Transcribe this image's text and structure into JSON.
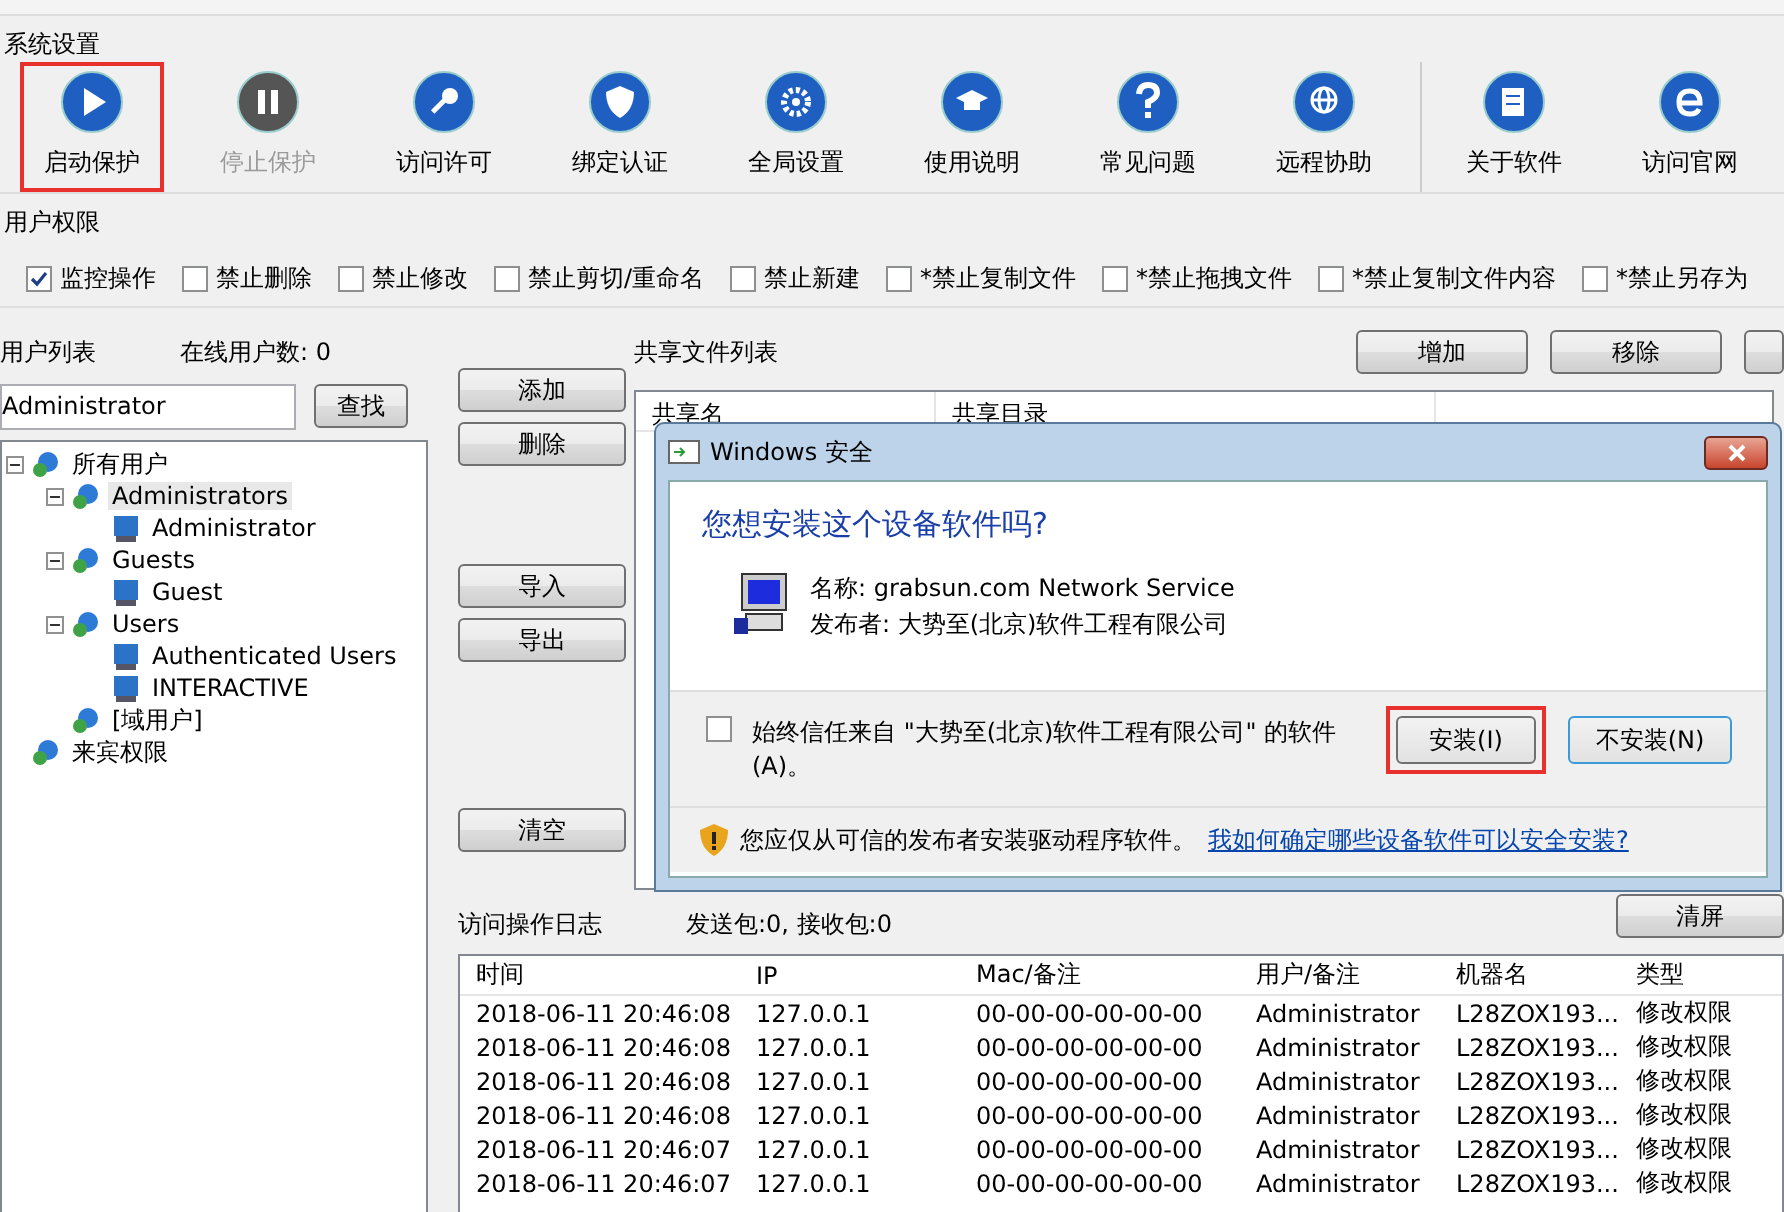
{
  "system_settings": {
    "title": "系统设置",
    "groups": [
      [
        {
          "label": "启动保护",
          "kind": "play",
          "disabled": false,
          "highlighted": true
        },
        {
          "label": "停止保护",
          "kind": "pause",
          "disabled": true,
          "highlighted": false
        },
        {
          "label": "访问许可",
          "kind": "key",
          "disabled": false,
          "highlighted": false
        },
        {
          "label": "绑定认证",
          "kind": "shield",
          "disabled": false,
          "highlighted": false
        },
        {
          "label": "全局设置",
          "kind": "gear",
          "disabled": false,
          "highlighted": false
        },
        {
          "label": "使用说明",
          "kind": "cap",
          "disabled": false,
          "highlighted": false
        },
        {
          "label": "常见问题",
          "kind": "question",
          "disabled": false,
          "highlighted": false
        },
        {
          "label": "远程协助",
          "kind": "globe",
          "disabled": false,
          "highlighted": false
        }
      ],
      [
        {
          "label": "关于软件",
          "kind": "note",
          "disabled": false,
          "highlighted": false
        },
        {
          "label": "访问官网",
          "kind": "browser",
          "disabled": false,
          "highlighted": false
        }
      ]
    ]
  },
  "user_permissions": {
    "title": "用户权限",
    "options": [
      {
        "label": "监控操作",
        "checked": true
      },
      {
        "label": "禁止删除",
        "checked": false
      },
      {
        "label": "禁止修改",
        "checked": false
      },
      {
        "label": "禁止剪切/重命名",
        "checked": false
      },
      {
        "label": "禁止新建",
        "checked": false
      },
      {
        "label": "*禁止复制文件",
        "checked": false
      },
      {
        "label": "*禁止拖拽文件",
        "checked": false
      },
      {
        "label": "*禁止复制文件内容",
        "checked": false
      },
      {
        "label": "*禁止另存为",
        "checked": false
      }
    ]
  },
  "user_list": {
    "title": "用户列表",
    "online_count": "在线用户数: 0",
    "search_value": "Administrator",
    "search_button": "查找",
    "tree": [
      {
        "label": "所有用户",
        "kind": "group",
        "expanded": true,
        "selected": false,
        "children": [
          {
            "label": "Administrators",
            "kind": "group",
            "expanded": true,
            "selected": true,
            "children": [
              {
                "label": "Administrator",
                "kind": "user",
                "selected": false
              }
            ]
          },
          {
            "label": "Guests",
            "kind": "group",
            "expanded": true,
            "selected": false,
            "children": [
              {
                "label": "Guest",
                "kind": "user",
                "selected": false
              }
            ]
          },
          {
            "label": "Users",
            "kind": "group",
            "expanded": true,
            "selected": false,
            "children": [
              {
                "label": "Authenticated Users",
                "kind": "user",
                "selected": false
              },
              {
                "label": "INTERACTIVE",
                "kind": "user",
                "selected": false
              }
            ]
          },
          {
            "label": "[域用户]",
            "kind": "group",
            "selected": false
          }
        ]
      },
      {
        "label": "来宾权限",
        "kind": "group",
        "selected": false
      }
    ]
  },
  "middle_buttons": {
    "top": [
      "添加",
      "删除"
    ],
    "middle": [
      "导入",
      "导出"
    ],
    "bottom": [
      "清空"
    ]
  },
  "share_list": {
    "title": "共享文件列表",
    "buttons": [
      "增加",
      "移除"
    ],
    "columns": [
      "共享名",
      "共享目录"
    ]
  },
  "log": {
    "title": "访问操作日志",
    "stats": "发送包:0, 接收包:0",
    "clear_button": "清屏",
    "columns": [
      "时间",
      "IP",
      "Mac/备注",
      "用户/备注",
      "机器名",
      "类型"
    ],
    "rows": [
      [
        "2018-06-11 20:46:08",
        "127.0.0.1",
        "00-00-00-00-00-00",
        "Administrator",
        "L28ZOX193...",
        "修改权限"
      ],
      [
        "2018-06-11 20:46:08",
        "127.0.0.1",
        "00-00-00-00-00-00",
        "Administrator",
        "L28ZOX193...",
        "修改权限"
      ],
      [
        "2018-06-11 20:46:08",
        "127.0.0.1",
        "00-00-00-00-00-00",
        "Administrator",
        "L28ZOX193...",
        "修改权限"
      ],
      [
        "2018-06-11 20:46:08",
        "127.0.0.1",
        "00-00-00-00-00-00",
        "Administrator",
        "L28ZOX193...",
        "修改权限"
      ],
      [
        "2018-06-11 20:46:07",
        "127.0.0.1",
        "00-00-00-00-00-00",
        "Administrator",
        "L28ZOX193...",
        "修改权限"
      ],
      [
        "2018-06-11 20:46:07",
        "127.0.0.1",
        "00-00-00-00-00-00",
        "Administrator",
        "L28ZOX193...",
        "修改权限"
      ]
    ]
  },
  "dialog": {
    "title": "Windows 安全",
    "heading": "您想安装这个设备软件吗?",
    "name": "名称: grabsun.com Network Service",
    "publisher": "发布者: 大势至(北京)软件工程有限公司",
    "trust": {
      "label": "始终信任来自 \"大势至(北京)软件工程有限公司\" 的软件(A)。",
      "checked": false
    },
    "buttons": [
      {
        "label": "安装(I)",
        "default": false,
        "highlighted": true
      },
      {
        "label": "不安装(N)",
        "default": true,
        "highlighted": false
      }
    ],
    "footer": "您应仅从可信的发布者安装驱动程序软件。",
    "link": "我如何确定哪些设备软件可以安全安装?"
  }
}
